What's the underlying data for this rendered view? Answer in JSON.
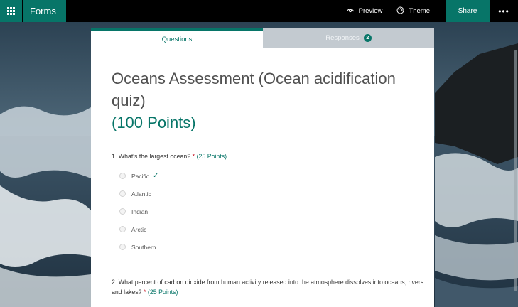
{
  "app": {
    "name": "Forms"
  },
  "toolbar": {
    "preview_label": "Preview",
    "theme_label": "Theme",
    "share_label": "Share",
    "more_label": "•••"
  },
  "tabs": {
    "questions": "Questions",
    "responses": "Responses",
    "responses_count": "2"
  },
  "form": {
    "title": "Oceans Assessment (Ocean acidification quiz)",
    "points": "(100 Points)"
  },
  "questions": [
    {
      "text": "1. What's the largest ocean?",
      "required_mark": "*",
      "points": "(25 Points)",
      "options": [
        "Pacific",
        "Atlantic",
        "Indian",
        "Arctic",
        "Southern"
      ],
      "correct": "Pacific"
    },
    {
      "text": "2. What percent of carbon dioxide from human activity released into the atmosphere dissolves into oceans, rivers and lakes?",
      "required_mark": "*",
      "points": "(25 Points)"
    }
  ],
  "colors": {
    "accent": "#077568",
    "topbar": "#000000",
    "required": "#c50f1f"
  },
  "icons": [
    "waffle-icon",
    "preview-eye-icon",
    "theme-palette-icon",
    "check-icon"
  ]
}
